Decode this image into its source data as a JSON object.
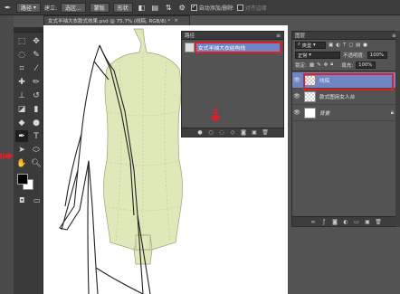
{
  "options_bar": {
    "mode_value": "路径",
    "build_label": "建立:",
    "selection_btn": "选区...",
    "mask_btn": "蒙版",
    "shape_btn": "形状",
    "auto_add_delete": "自动添加/删除",
    "align_edges": "对齐边缘"
  },
  "document": {
    "tab_title": "女式半袖大衣款式效果.psd @ 75.7% (线稿, RGB/8) *",
    "close_glyph": "×"
  },
  "paths_panel": {
    "title": "路径",
    "menu_glyph": "≡",
    "items": [
      {
        "name": "女式半袖大衣结构线"
      }
    ]
  },
  "layers_panel": {
    "title": "图层",
    "menu_glyph": "≡",
    "filter_label": "类型",
    "blend_mode": "正常",
    "opacity_label": "不透明度:",
    "opacity_value": "100%",
    "lock_label": "锁定:",
    "fill_label": "填充:",
    "fill_value": "100%",
    "layers": [
      {
        "name": "线稿",
        "selected": true
      },
      {
        "name": "款式图用女人台",
        "selected": false
      },
      {
        "name": "背景",
        "selected": false,
        "locked": true
      }
    ]
  },
  "colors": {
    "accent_red": "#e31e24",
    "selection_blue": "#6f86c4",
    "form_fill": "#dfe8b8"
  }
}
